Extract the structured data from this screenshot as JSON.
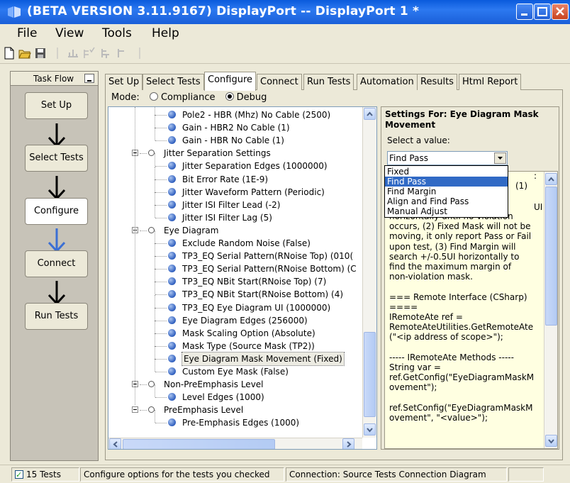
{
  "window": {
    "title": "(BETA VERSION 3.11.9167) DisplayPort -- DisplayPort 1 *"
  },
  "menu": [
    "File",
    "View",
    "Tools",
    "Help"
  ],
  "task_flow": {
    "label": "Task Flow",
    "steps": [
      "Set Up",
      "Select Tests",
      "Configure",
      "Connect",
      "Run Tests"
    ],
    "active": "Configure"
  },
  "tabs": [
    "Set Up",
    "Select Tests",
    "Configure",
    "Connect",
    "Run Tests",
    "Automation",
    "Results",
    "Html Report"
  ],
  "active_tab": "Configure",
  "mode": {
    "label": "Mode:",
    "options": [
      "Compliance",
      "Debug"
    ],
    "selected": "Debug"
  },
  "tree": {
    "items": [
      {
        "text": "Pole2 - HBR (Mhz) No Cable (2500)",
        "kind": "leaf"
      },
      {
        "text": "Gain - HBR2 No Cable (1)",
        "kind": "leaf"
      },
      {
        "text": "Gain - HBR No Cable (1)",
        "kind": "leaf"
      },
      {
        "text": "Jitter Separation Settings",
        "kind": "group"
      },
      {
        "text": "Jitter Separation Edges (1000000)",
        "kind": "leaf"
      },
      {
        "text": "Bit Error Rate (1E-9)",
        "kind": "leaf"
      },
      {
        "text": "Jitter Waveform Pattern (Periodic)",
        "kind": "leaf"
      },
      {
        "text": "Jitter ISI Filter Lead (-2)",
        "kind": "leaf"
      },
      {
        "text": "Jitter ISI Filter Lag (5)",
        "kind": "leaf"
      },
      {
        "text": "Eye Diagram",
        "kind": "group"
      },
      {
        "text": "Exclude Random Noise (False)",
        "kind": "leaf"
      },
      {
        "text": "TP3_EQ Serial Pattern(RNoise Top) (010(",
        "kind": "leaf"
      },
      {
        "text": "TP3_EQ Serial Pattern(RNoise Bottom) (C",
        "kind": "leaf"
      },
      {
        "text": "TP3_EQ NBit Start(RNoise Top) (7)",
        "kind": "leaf"
      },
      {
        "text": "TP3_EQ NBit Start(RNoise Bottom) (4)",
        "kind": "leaf"
      },
      {
        "text": "TP3_EQ Eye Diagram UI (1000000)",
        "kind": "leaf"
      },
      {
        "text": "Eye Diagram Edges (256000)",
        "kind": "leaf"
      },
      {
        "text": "Mask Scaling Option (Absolute)",
        "kind": "leaf"
      },
      {
        "text": "Mask Type (Source Mask (TP2))",
        "kind": "leaf"
      },
      {
        "text": "Eye Diagram Mask Movement (Fixed)",
        "kind": "leaf",
        "selected": true
      },
      {
        "text": "Custom Eye Mask (False)",
        "kind": "leaf"
      },
      {
        "text": "Non-PreEmphasis Level",
        "kind": "group"
      },
      {
        "text": "Level Edges (1000)",
        "kind": "leaf"
      },
      {
        "text": "PreEmphasis Level",
        "kind": "group"
      },
      {
        "text": "Pre-Emphasis Edges (1000)",
        "kind": "leaf"
      }
    ]
  },
  "settings": {
    "title": "Settings For: Eye Diagram Mask Movement",
    "prompt": "Select a value:",
    "value": "Find Pass",
    "options": [
      "Fixed",
      "Find Pass",
      "Find Margin",
      "Align and Find Pass",
      "Manual Adjust"
    ],
    "highlighted": "Find Pass",
    "description_peek": [
      ":",
      "(1)",
      "UI"
    ],
    "description": "horizontally until no violation\noccurs, (2) Fixed Mask will not be\nmoving, it only report Pass or Fail\nupon test, (3) Find Margin will\nsearch +/-0.5UI horizontally to\nfind the maximum margin of\nnon-violation mask.\n\n=== Remote Interface (CSharp)\n====\nIRemoteAte ref =\nRemoteAteUtilities.GetRemoteAte\n(\"<ip address of scope>\");\n\n----- IRemoteAte Methods -----\nString var =\nref.GetConfig(\"EyeDiagramMaskM\novement\");\n\nref.SetConfig(\"EyeDiagramMaskM\novement\", \"<value>\");"
  },
  "status": {
    "tests": "15 Tests",
    "message": "Configure options for the tests you checked",
    "connection": "Connection: Source Tests Connection Diagram"
  },
  "colors": {
    "title_bar": "#1a5fd8",
    "highlight": "#316ac5",
    "description_bg": "#ffffe1",
    "flow_arrow_active": "#3b6fd4"
  }
}
